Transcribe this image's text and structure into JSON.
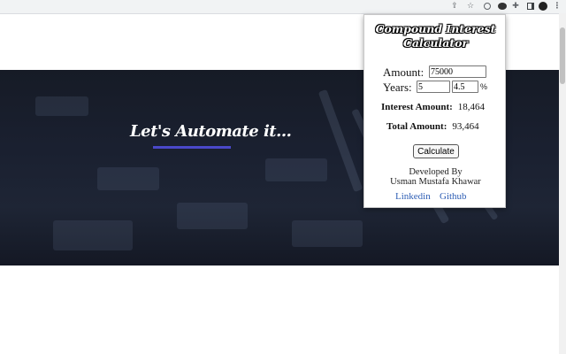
{
  "browser": {
    "icons": [
      "share-icon",
      "star-icon",
      "extension-icon",
      "extension-icon",
      "puzzle-icon",
      "sidebar-icon",
      "profile-avatar",
      "menu-icon"
    ]
  },
  "hero": {
    "title": "Let's Automate it...",
    "accent": "#4a48c9",
    "background": "#161b26"
  },
  "popup": {
    "title_line1": "Compound Interest",
    "title_line2": "Calculator",
    "amount_label": "Amount:",
    "amount_value": "75000",
    "years_label": "Years:",
    "years_value": "5",
    "rate_value": "4.5",
    "percent_sign": "%",
    "interest_label": "Interest Amount:",
    "interest_value": "18,464",
    "total_label": "Total Amount:",
    "total_value": "93,464",
    "calculate_label": "Calculate",
    "developed_by": "Developed By",
    "developer_name": "Usman Mustafa Khawar",
    "linkedin_label": "Linkedin",
    "github_label": "Github",
    "link_color": "#2f5fb5"
  }
}
